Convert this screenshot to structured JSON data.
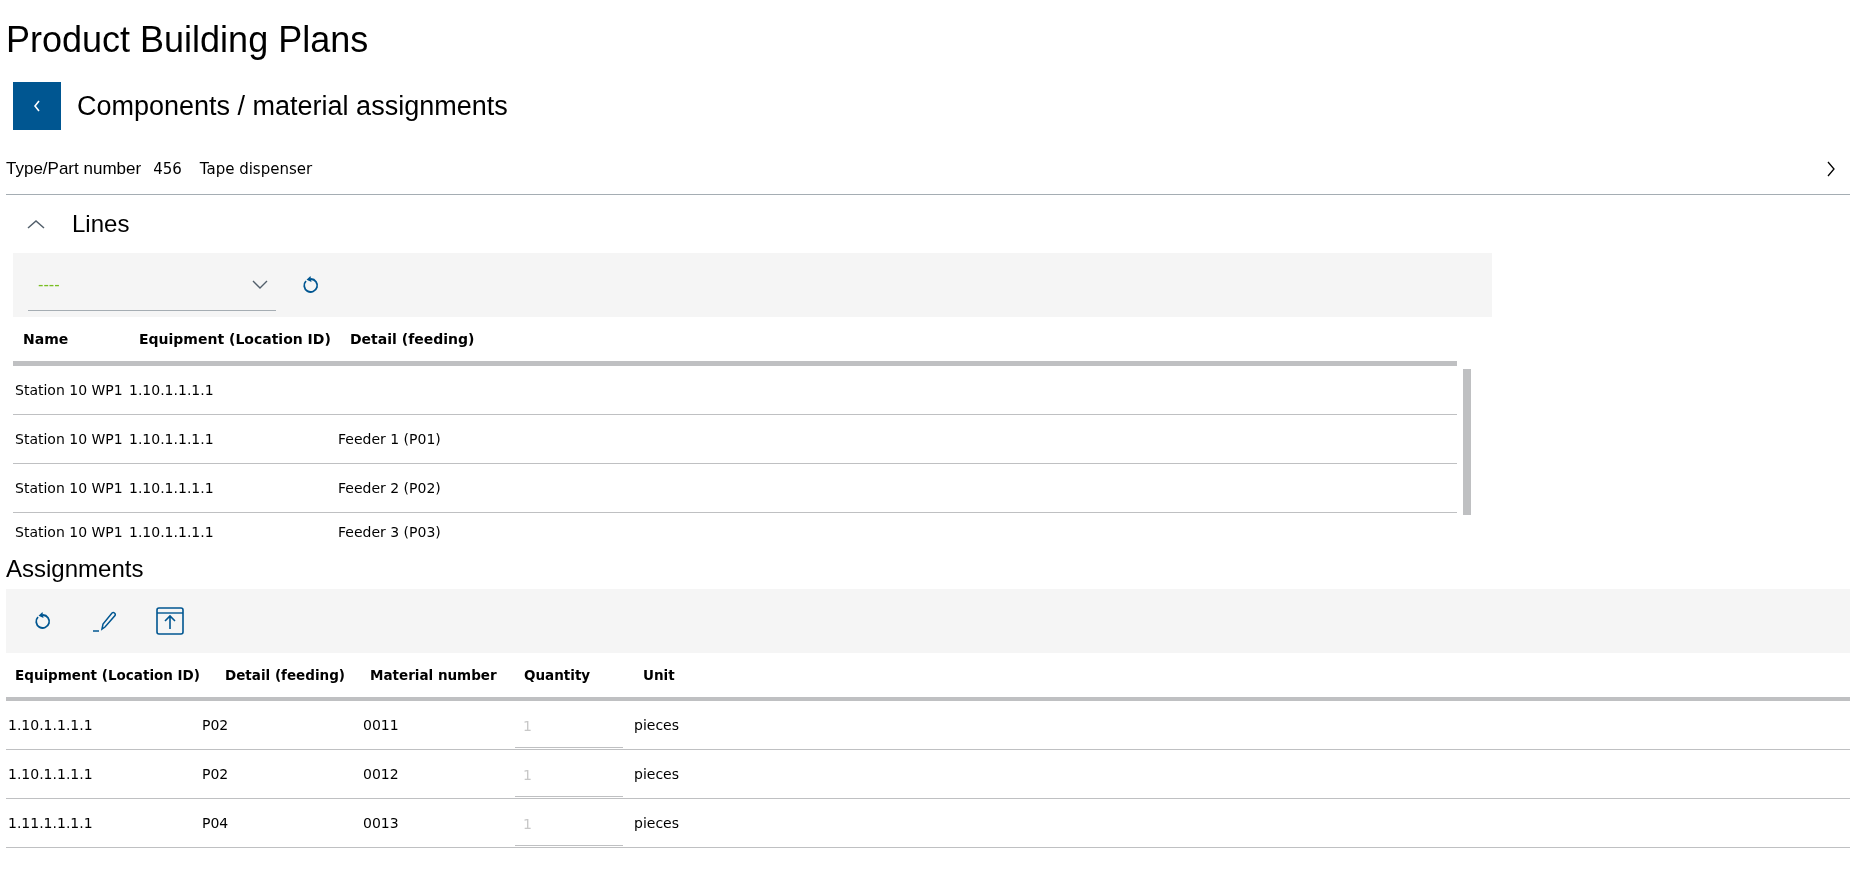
{
  "page_title": "Product Building Plans",
  "header": {
    "title": "Components / material assignments"
  },
  "part": {
    "label": "Type/Part number",
    "number": "456",
    "name": "Tape dispenser"
  },
  "lines": {
    "title": "Lines",
    "expanded": true,
    "filter": {
      "value": "----"
    },
    "columns": [
      "Name",
      "Equipment (Location ID)",
      "Detail (feeding)"
    ],
    "rows": [
      {
        "cells": [
          "Station 10 WP1",
          "1.10.1.1.1.1",
          ""
        ]
      },
      {
        "cells": [
          "Station 10 WP1",
          "1.10.1.1.1.1",
          "Feeder 1 (P01)"
        ]
      },
      {
        "cells": [
          "Station 10 WP1",
          "1.10.1.1.1.1",
          "Feeder 2 (P02)"
        ]
      },
      {
        "cells": [
          "Station 10 WP1",
          "1.10.1.1.1.1",
          "Feeder 3 (P03)"
        ]
      }
    ]
  },
  "assignments": {
    "title": "Assignments",
    "columns": [
      "Equipment (Location ID)",
      "Detail (feeding)",
      "Material number",
      "Quantity",
      "Unit"
    ],
    "rows": [
      {
        "equipment": "1.10.1.1.1.1",
        "detail": "P02",
        "material": "0011",
        "quantity": "1",
        "unit": "pieces"
      },
      {
        "equipment": "1.10.1.1.1.1",
        "detail": "P02",
        "material": "0012",
        "quantity": "1",
        "unit": "pieces"
      },
      {
        "equipment": "1.11.1.1.1.1",
        "detail": "P04",
        "material": "0013",
        "quantity": "1",
        "unit": "pieces"
      }
    ]
  }
}
